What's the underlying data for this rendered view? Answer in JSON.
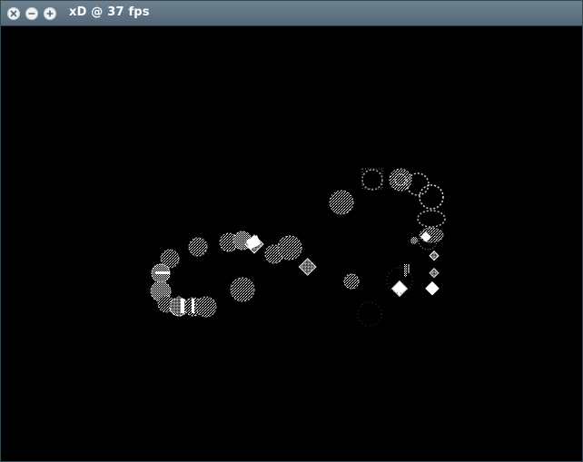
{
  "window": {
    "title": "xD @ 37 fps",
    "close_icon": "close-icon",
    "minimize_icon": "minimize-icon",
    "maximize_icon": "maximize-icon"
  },
  "scene": {
    "background": "#000000",
    "particle_color": "#ffffff"
  }
}
